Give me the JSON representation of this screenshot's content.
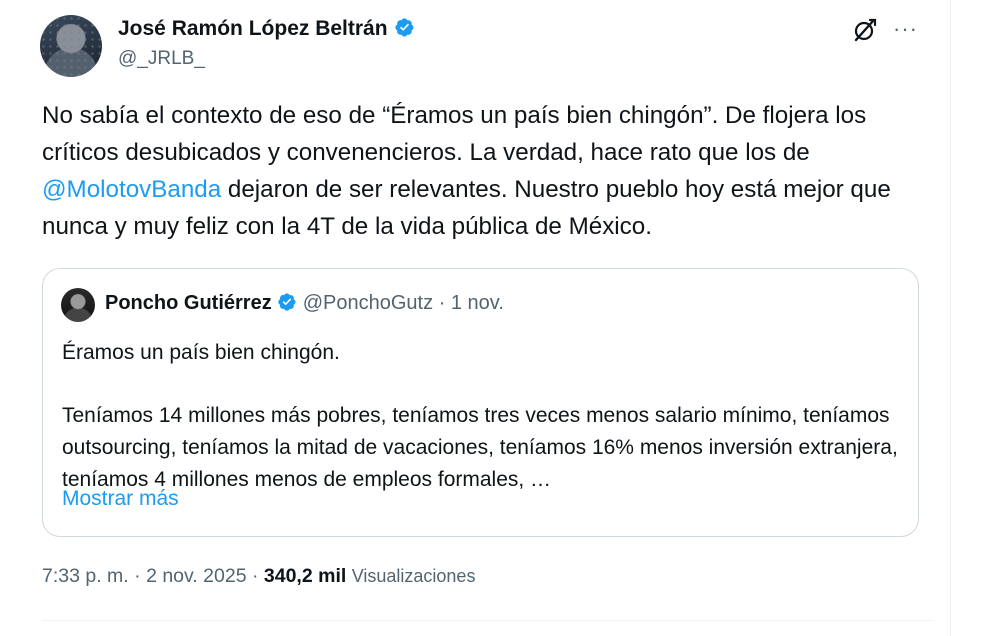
{
  "author": {
    "display_name": "José Ramón López Beltrán",
    "handle": "@_JRLB_"
  },
  "tweet": {
    "text_before_mention": "No sabía el contexto de eso de “Éramos un país bien chingón”. De flojera los críticos desubicados y convenencieros. La verdad, hace rato que los de ",
    "mention": "@MolotovBanda",
    "text_after_mention": " dejaron de ser relevantes. Nuestro pueblo hoy está mejor que nunca y muy feliz con la 4T de la vida pública de México."
  },
  "quote": {
    "display_name": "Poncho Gutiérrez",
    "handle": "@PonchoGutz",
    "separator": "·",
    "date": "1 nov.",
    "line1": "Éramos un país bien chingón.",
    "line2": "Teníamos 14 millones más pobres, teníamos tres veces menos salario mínimo, teníamos outsourcing, teníamos la mitad de vacaciones, teníamos 16% menos inversión extranjera, teníamos 4 millones menos de empleos formales, …",
    "show_more": "Mostrar más"
  },
  "meta": {
    "time": "7:33 p. m.",
    "sep1": "·",
    "date": "2 nov. 2025",
    "sep2": "·",
    "views_count": "340,2 mil",
    "views_label": "Visualizaciones"
  },
  "icons": {
    "verified": "verified-badge-icon",
    "grok": "grok-icon",
    "more": "more-options-icon"
  },
  "colors": {
    "accent": "#1d9bf0",
    "secondary_text": "#536471",
    "primary_text": "#0f1419",
    "border": "#cfd9de"
  }
}
